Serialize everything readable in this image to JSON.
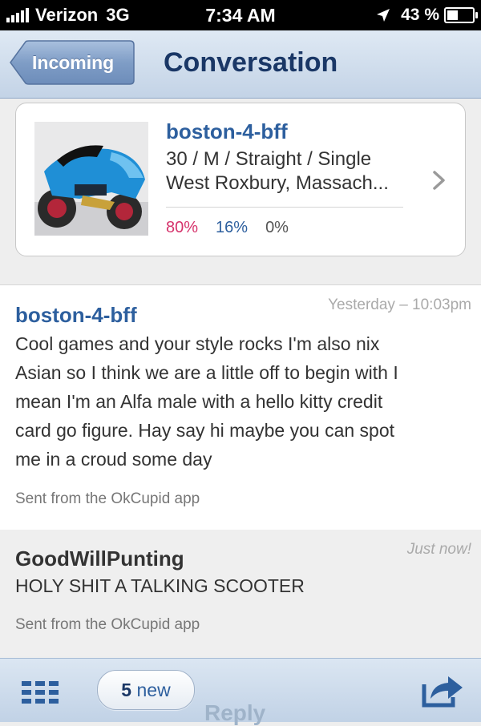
{
  "status_bar": {
    "carrier": "Verizon",
    "network": "3G",
    "time": "7:34 AM",
    "battery_percent": "43 %",
    "battery_level": 0.43,
    "icons": [
      "signal-bars-icon",
      "location-arrow-icon",
      "battery-icon"
    ]
  },
  "nav": {
    "back_label": "Incoming",
    "title": "Conversation"
  },
  "profile": {
    "username": "boston-4-bff",
    "details": "30 / M / Straight / Single",
    "location": "West Roxbury, Massach...",
    "match": "80%",
    "friend": "16%",
    "enemy": "0%",
    "avatar_icon": "motorcycle-photo",
    "colors": {
      "match": "#d6336c",
      "friend": "#2d5f9e",
      "enemy": "#555555"
    }
  },
  "messages": [
    {
      "sender": "boston-4-bff",
      "timestamp": "Yesterday – 10:03pm",
      "lines": [
        "Cool games and your style rocks I'm also nix",
        "Asian so I think we are a little off to begin with I",
        "mean I'm an Alfa male with a hello kitty credit",
        "card go figure. Hay say hi maybe you can spot",
        "me in a croud some day"
      ],
      "footer": "Sent from the OkCupid app",
      "sender_color": "#2d5f9e"
    },
    {
      "sender": "GoodWillPunting",
      "timestamp": "Just now!",
      "lines": [
        "HOLY SHIT A TALKING SCOOTER"
      ],
      "footer": "Sent from the OkCupid app",
      "sender_color": "#333333"
    }
  ],
  "toolbar": {
    "new_count": "5",
    "new_word": "new",
    "reply_label": "Reply",
    "icons": [
      "grid-menu-icon",
      "share-arrow-icon"
    ]
  }
}
